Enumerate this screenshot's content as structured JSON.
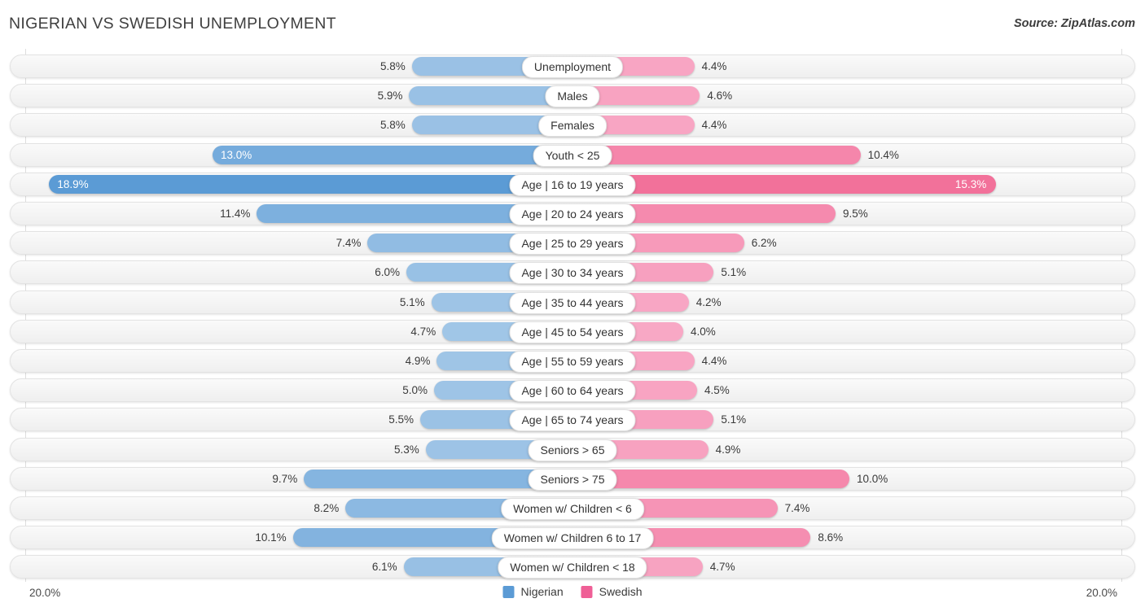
{
  "header": {
    "title": "NIGERIAN VS SWEDISH UNEMPLOYMENT",
    "source": "Source: ZipAtlas.com"
  },
  "axis": {
    "left_max_label": "20.0%",
    "right_max_label": "20.0%",
    "max_value": 20.0
  },
  "legend": {
    "items": [
      {
        "label": "Nigerian",
        "color": "#5b9bd5"
      },
      {
        "label": "Swedish",
        "color": "#ef5f96"
      }
    ]
  },
  "colors": {
    "nigerian_light": "#a6c9e8",
    "nigerian_dark": "#5b9bd5",
    "swedish_light": "#f8a8c5",
    "swedish_dark": "#f1628f",
    "track": "#f4f4f4",
    "gridline": "#dedede"
  },
  "chart_data": {
    "type": "bar",
    "subtype": "diverging-bidirectional",
    "title": "NIGERIAN VS SWEDISH UNEMPLOYMENT",
    "xlabel": "",
    "ylabel": "",
    "xlim": [
      20.0,
      20.0
    ],
    "grid": true,
    "legend_position": "bottom-center",
    "categories": [
      "Unemployment",
      "Males",
      "Females",
      "Youth < 25",
      "Age | 16 to 19 years",
      "Age | 20 to 24 years",
      "Age | 25 to 29 years",
      "Age | 30 to 34 years",
      "Age | 35 to 44 years",
      "Age | 45 to 54 years",
      "Age | 55 to 59 years",
      "Age | 60 to 64 years",
      "Age | 65 to 74 years",
      "Seniors > 65",
      "Seniors > 75",
      "Women w/ Children < 6",
      "Women w/ Children 6 to 17",
      "Women w/ Children < 18"
    ],
    "series": [
      {
        "name": "Nigerian",
        "side": "left",
        "color": "#5b9bd5",
        "values": [
          5.8,
          5.9,
          5.8,
          13.0,
          18.9,
          11.4,
          7.4,
          6.0,
          5.1,
          4.7,
          4.9,
          5.0,
          5.5,
          5.3,
          9.7,
          8.2,
          10.1,
          6.1
        ],
        "labels": [
          "5.8%",
          "5.9%",
          "5.8%",
          "13.0%",
          "18.9%",
          "11.4%",
          "7.4%",
          "6.0%",
          "5.1%",
          "4.7%",
          "4.9%",
          "5.0%",
          "5.5%",
          "5.3%",
          "9.7%",
          "8.2%",
          "10.1%",
          "6.1%"
        ]
      },
      {
        "name": "Swedish",
        "side": "right",
        "color": "#ef5f96",
        "values": [
          4.4,
          4.6,
          4.4,
          10.4,
          15.3,
          9.5,
          6.2,
          5.1,
          4.2,
          4.0,
          4.4,
          4.5,
          5.1,
          4.9,
          10.0,
          7.4,
          8.6,
          4.7
        ],
        "labels": [
          "4.4%",
          "4.6%",
          "4.4%",
          "10.4%",
          "15.3%",
          "9.5%",
          "6.2%",
          "5.1%",
          "4.2%",
          "4.0%",
          "4.4%",
          "4.5%",
          "5.1%",
          "4.9%",
          "10.0%",
          "7.4%",
          "8.6%",
          "4.7%"
        ]
      }
    ],
    "rows": [
      {
        "category": "Unemployment",
        "nigerian": 5.8,
        "nigerian_label": "5.8%",
        "swedish": 4.4,
        "swedish_label": "4.4%"
      },
      {
        "category": "Males",
        "nigerian": 5.9,
        "nigerian_label": "5.9%",
        "swedish": 4.6,
        "swedish_label": "4.6%"
      },
      {
        "category": "Females",
        "nigerian": 5.8,
        "nigerian_label": "5.8%",
        "swedish": 4.4,
        "swedish_label": "4.4%"
      },
      {
        "category": "Youth < 25",
        "nigerian": 13.0,
        "nigerian_label": "13.0%",
        "swedish": 10.4,
        "swedish_label": "10.4%"
      },
      {
        "category": "Age | 16 to 19 years",
        "nigerian": 18.9,
        "nigerian_label": "18.9%",
        "swedish": 15.3,
        "swedish_label": "15.3%"
      },
      {
        "category": "Age | 20 to 24 years",
        "nigerian": 11.4,
        "nigerian_label": "11.4%",
        "swedish": 9.5,
        "swedish_label": "9.5%"
      },
      {
        "category": "Age | 25 to 29 years",
        "nigerian": 7.4,
        "nigerian_label": "7.4%",
        "swedish": 6.2,
        "swedish_label": "6.2%"
      },
      {
        "category": "Age | 30 to 34 years",
        "nigerian": 6.0,
        "nigerian_label": "6.0%",
        "swedish": 5.1,
        "swedish_label": "5.1%"
      },
      {
        "category": "Age | 35 to 44 years",
        "nigerian": 5.1,
        "nigerian_label": "5.1%",
        "swedish": 4.2,
        "swedish_label": "4.2%"
      },
      {
        "category": "Age | 45 to 54 years",
        "nigerian": 4.7,
        "nigerian_label": "4.7%",
        "swedish": 4.0,
        "swedish_label": "4.0%"
      },
      {
        "category": "Age | 55 to 59 years",
        "nigerian": 4.9,
        "nigerian_label": "4.9%",
        "swedish": 4.4,
        "swedish_label": "4.4%"
      },
      {
        "category": "Age | 60 to 64 years",
        "nigerian": 5.0,
        "nigerian_label": "5.0%",
        "swedish": 4.5,
        "swedish_label": "4.5%"
      },
      {
        "category": "Age | 65 to 74 years",
        "nigerian": 5.5,
        "nigerian_label": "5.5%",
        "swedish": 5.1,
        "swedish_label": "5.1%"
      },
      {
        "category": "Seniors > 65",
        "nigerian": 5.3,
        "nigerian_label": "5.3%",
        "swedish": 4.9,
        "swedish_label": "4.9%"
      },
      {
        "category": "Seniors > 75",
        "nigerian": 9.7,
        "nigerian_label": "9.7%",
        "swedish": 10.0,
        "swedish_label": "10.0%"
      },
      {
        "category": "Women w/ Children < 6",
        "nigerian": 8.2,
        "nigerian_label": "8.2%",
        "swedish": 7.4,
        "swedish_label": "7.4%"
      },
      {
        "category": "Women w/ Children 6 to 17",
        "nigerian": 10.1,
        "nigerian_label": "10.1%",
        "swedish": 8.6,
        "swedish_label": "8.6%"
      },
      {
        "category": "Women w/ Children < 18",
        "nigerian": 6.1,
        "nigerian_label": "6.1%",
        "swedish": 4.7,
        "swedish_label": "4.7%"
      }
    ]
  }
}
